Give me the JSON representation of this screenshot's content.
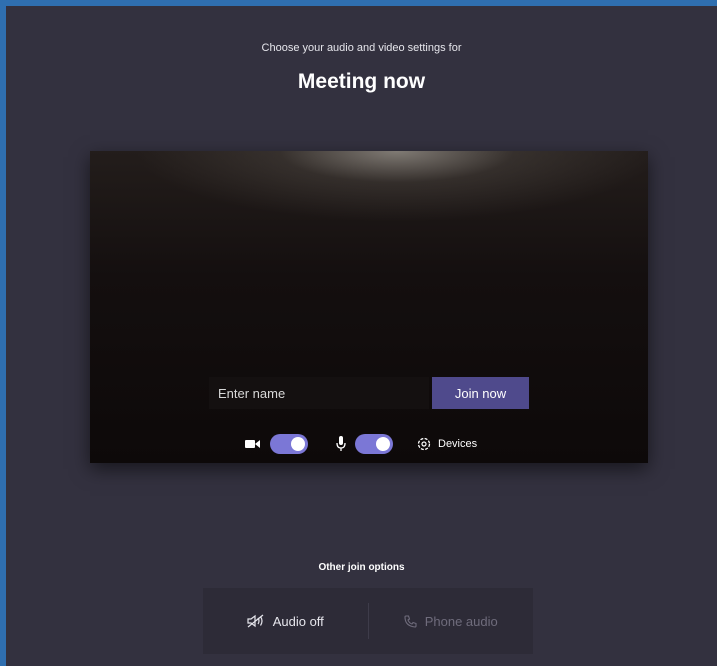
{
  "header": {
    "subtitle": "Choose your audio and video settings for",
    "title": "Meeting now"
  },
  "preview": {
    "name_placeholder": "Enter name",
    "join_label": "Join now",
    "camera_enabled": true,
    "microphone_enabled": true,
    "devices_label": "Devices",
    "icons": [
      "video-camera-icon",
      "microphone-icon",
      "gear-icon"
    ]
  },
  "other_options": {
    "label": "Other join options",
    "audio_off_label": "Audio off",
    "phone_audio_label": "Phone audio",
    "icons": [
      "speaker-off-icon",
      "phone-icon"
    ]
  },
  "colors": {
    "background": "#33313f",
    "accent": "#4f4a8c",
    "toggle_on": "#7b77d6",
    "frame": "#2f6fb0"
  }
}
